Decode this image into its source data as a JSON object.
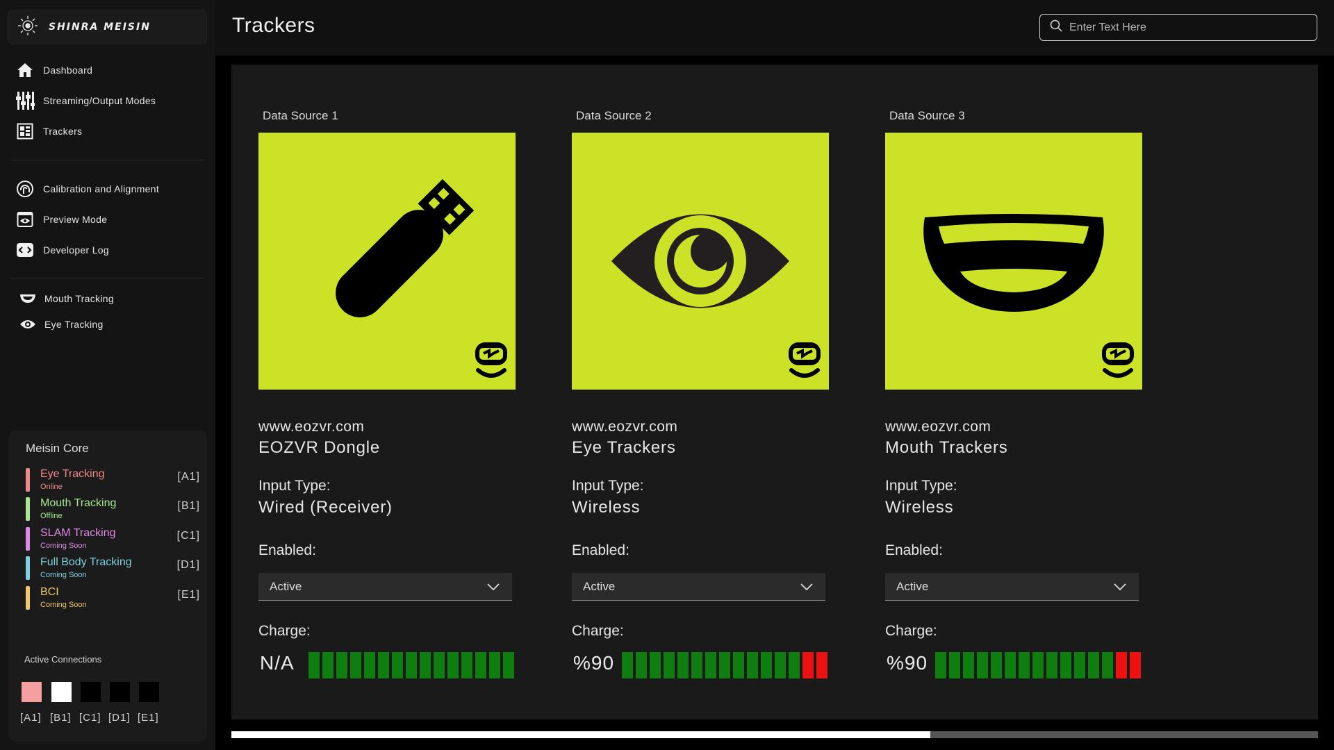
{
  "app": {
    "brand": "SHINRA MEISIN"
  },
  "header": {
    "title": "Trackers",
    "search_placeholder": "Enter Text Here"
  },
  "sidebar": {
    "primary": [
      {
        "label": "Dashboard",
        "icon": "home-icon"
      },
      {
        "label": "Streaming/Output Modes",
        "icon": "sliders-icon"
      },
      {
        "label": "Trackers",
        "icon": "grid-icon"
      }
    ],
    "secondary": [
      {
        "label": "Calibration and Alignment",
        "icon": "fingerprint-icon"
      },
      {
        "label": "Preview Mode",
        "icon": "eye-window-icon"
      },
      {
        "label": "Developer Log",
        "icon": "code-icon"
      }
    ],
    "tracking": [
      {
        "label": "Mouth Tracking",
        "icon": "mouth-icon"
      },
      {
        "label": "Eye Tracking",
        "icon": "eye-icon"
      }
    ]
  },
  "core": {
    "title": "Meisin Core",
    "items": [
      {
        "name": "Eye Tracking",
        "status": "Online",
        "code": "[A1]",
        "color": "#f08a8a"
      },
      {
        "name": "Mouth Tracking",
        "status": "Offline",
        "code": "[B1]",
        "color": "#a8e890"
      },
      {
        "name": "SLAM Tracking",
        "status": "Coming Soon",
        "code": "[C1]",
        "color": "#e08ae8"
      },
      {
        "name": "Full Body Tracking",
        "status": "Coming Soon",
        "code": "[D1]",
        "color": "#7fd0e0"
      },
      {
        "name": "BCI",
        "status": "Coming Soon",
        "code": "[E1]",
        "color": "#f0c86a"
      }
    ],
    "connections_title": "Active Connections",
    "connections": [
      {
        "label": "[A1]",
        "color": "#f4a0a0"
      },
      {
        "label": "[B1]",
        "color": "#ffffff"
      },
      {
        "label": "[C1]",
        "color": "#000000"
      },
      {
        "label": "[D1]",
        "color": "#000000"
      },
      {
        "label": "[E1]",
        "color": "#000000"
      }
    ]
  },
  "sources": [
    {
      "label": "Data Source 1",
      "site": "www.eozvr.com",
      "name": "EOZVR Dongle",
      "input_label": "Input Type:",
      "input_value": "Wired (Receiver)",
      "enabled_label": "Enabled:",
      "enabled_value": "Active",
      "charge_label": "Charge:",
      "charge_value": "N/A",
      "charge_segments": 15,
      "charge_red": 0,
      "image": "usb-dongle-icon"
    },
    {
      "label": "Data Source 2",
      "site": "www.eozvr.com",
      "name": "Eye Trackers",
      "input_label": "Input Type:",
      "input_value": "Wireless",
      "enabled_label": "Enabled:",
      "enabled_value": "Active",
      "charge_label": "Charge:",
      "charge_value": "%90",
      "charge_segments": 15,
      "charge_red": 2,
      "image": "eye-icon"
    },
    {
      "label": "Data Source 3",
      "site": "www.eozvr.com",
      "name": "Mouth Trackers",
      "input_label": "Input Type:",
      "input_value": "Wireless",
      "enabled_label": "Enabled:",
      "enabled_value": "Active",
      "charge_label": "Charge:",
      "charge_value": "%90",
      "charge_segments": 15,
      "charge_red": 2,
      "image": "mouth-icon"
    }
  ],
  "colors": {
    "accent": "#cce227",
    "charge_green": "#0f7d0f",
    "charge_red": "#ee1111"
  },
  "scroll_progress": 0.643
}
